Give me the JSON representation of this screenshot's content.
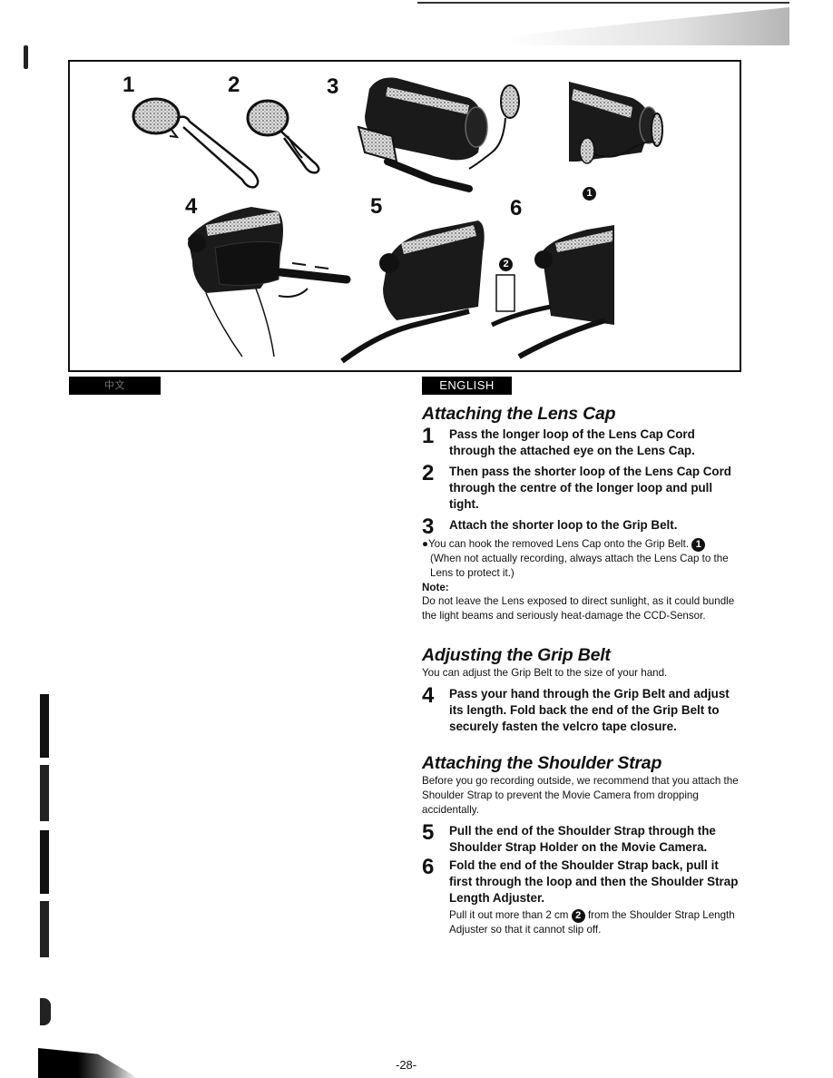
{
  "figure": {
    "labels": [
      "1",
      "2",
      "3",
      "4",
      "5",
      "6"
    ],
    "callouts": [
      "1",
      "2"
    ]
  },
  "language_tabs": {
    "left": "中文",
    "right": "ENGLISH"
  },
  "sections": {
    "lens_cap": {
      "title": "Attaching the Lens Cap",
      "steps": [
        {
          "num": "1",
          "text": "Pass the longer loop of the Lens Cap Cord through the attached eye on the Lens Cap."
        },
        {
          "num": "2",
          "text": "Then pass the shorter loop of the Lens Cap Cord through the centre of the longer loop and pull tight."
        },
        {
          "num": "3",
          "text": "Attach the shorter loop to the Grip Belt."
        }
      ],
      "bullet": "You can hook the removed Lens Cap onto the Grip Belt.",
      "bullet_callout": "1",
      "bullet_cont": "(When not actually recording, always attach the Lens Cap to the Lens to protect it.)",
      "note_label": "Note:",
      "note_text": "Do not leave the Lens exposed to direct sunlight, as it could bundle the light beams and seriously heat-damage the CCD-Sensor."
    },
    "grip_belt": {
      "title": "Adjusting the Grip Belt",
      "intro": "You can adjust the Grip Belt to the size of your hand.",
      "steps": [
        {
          "num": "4",
          "text": "Pass your hand through the Grip Belt and adjust its length. Fold back the end of the Grip Belt to securely fasten the velcro tape closure."
        }
      ]
    },
    "shoulder_strap": {
      "title": "Attaching the Shoulder Strap",
      "intro": "Before you go recording outside, we recommend that you attach the Shoulder Strap to prevent the Movie Camera from dropping accidentally.",
      "steps": [
        {
          "num": "5",
          "text": "Pull the end of the Shoulder Strap through the Shoulder Strap Holder on the Movie Camera."
        },
        {
          "num": "6",
          "text": "Fold the end of the Shoulder Strap back, pull it first through the loop and then the Shoulder Strap Length Adjuster."
        }
      ],
      "sub_before": "Pull it out more than 2 cm",
      "sub_callout": "2",
      "sub_after": "from the Shoulder Strap Length Adjuster so that it cannot slip off."
    }
  },
  "page_number": "-28-"
}
